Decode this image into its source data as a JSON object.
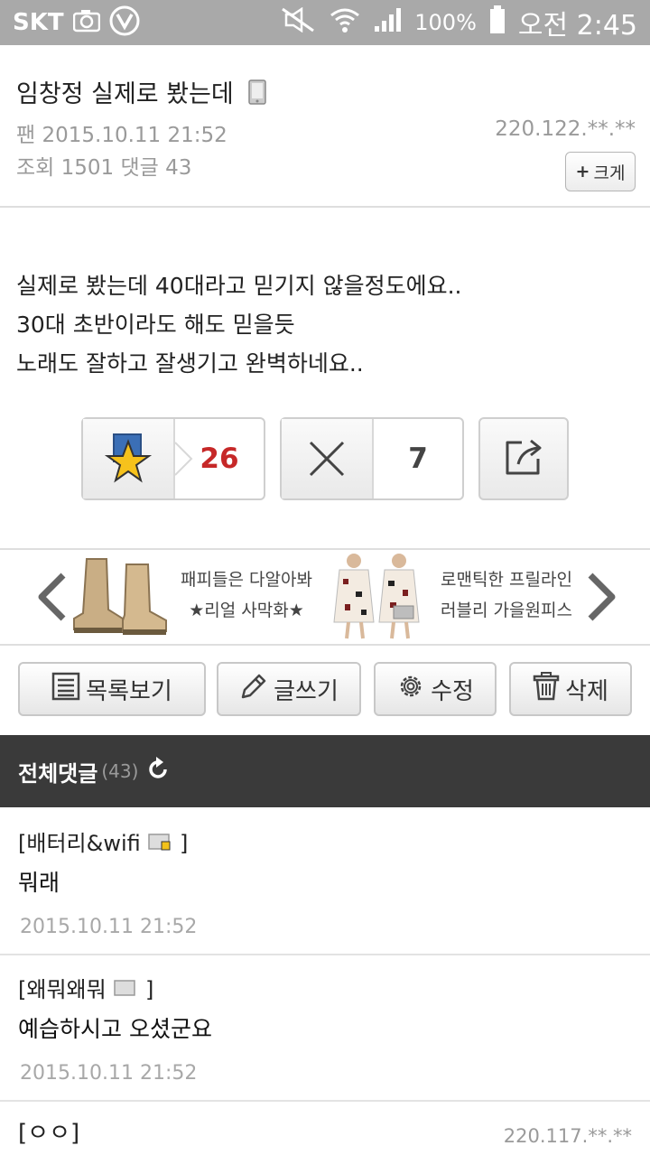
{
  "status": {
    "carrier": "SKT",
    "battery": "100%",
    "time": "오전 2:45"
  },
  "post": {
    "title": "임창정 실제로 봤는데",
    "board_date": "팬 2015.10.11 21:52",
    "views_label": "조회 1501 댓글 43",
    "ip": "220.122.**.**",
    "big_button": "크게",
    "body": [
      "실제로 봤는데 40대라고 믿기지 않을정도에요..",
      "30대 초반이라도 해도 믿을듯",
      "노래도 잘하고 잘생기고 완벽하네요.."
    ]
  },
  "votes": {
    "up": "26",
    "down": "7",
    "up_color": "#c62828"
  },
  "banner": {
    "left_text": [
      "패피들은 다알아봐",
      "★리얼 사막화★"
    ],
    "right_text": [
      "로맨틱한 프릴라인",
      "러블리 가을원피스"
    ]
  },
  "buttons": {
    "list": "목록보기",
    "write": "글쓰기",
    "edit": "수정",
    "delete": "삭제"
  },
  "comments_header": {
    "title": "전체댓글",
    "count": "(43)"
  },
  "comments": [
    {
      "author": "[배터리&wifi",
      "text": "뭐래",
      "date": "2015.10.11 21:52"
    },
    {
      "author": "[왜뭐왜뭐",
      "text": "예습하시고 오셨군요",
      "date": "2015.10.11 21:52"
    },
    {
      "author": "[ㅇㅇ]",
      "ip": "220.117.**.**"
    }
  ]
}
